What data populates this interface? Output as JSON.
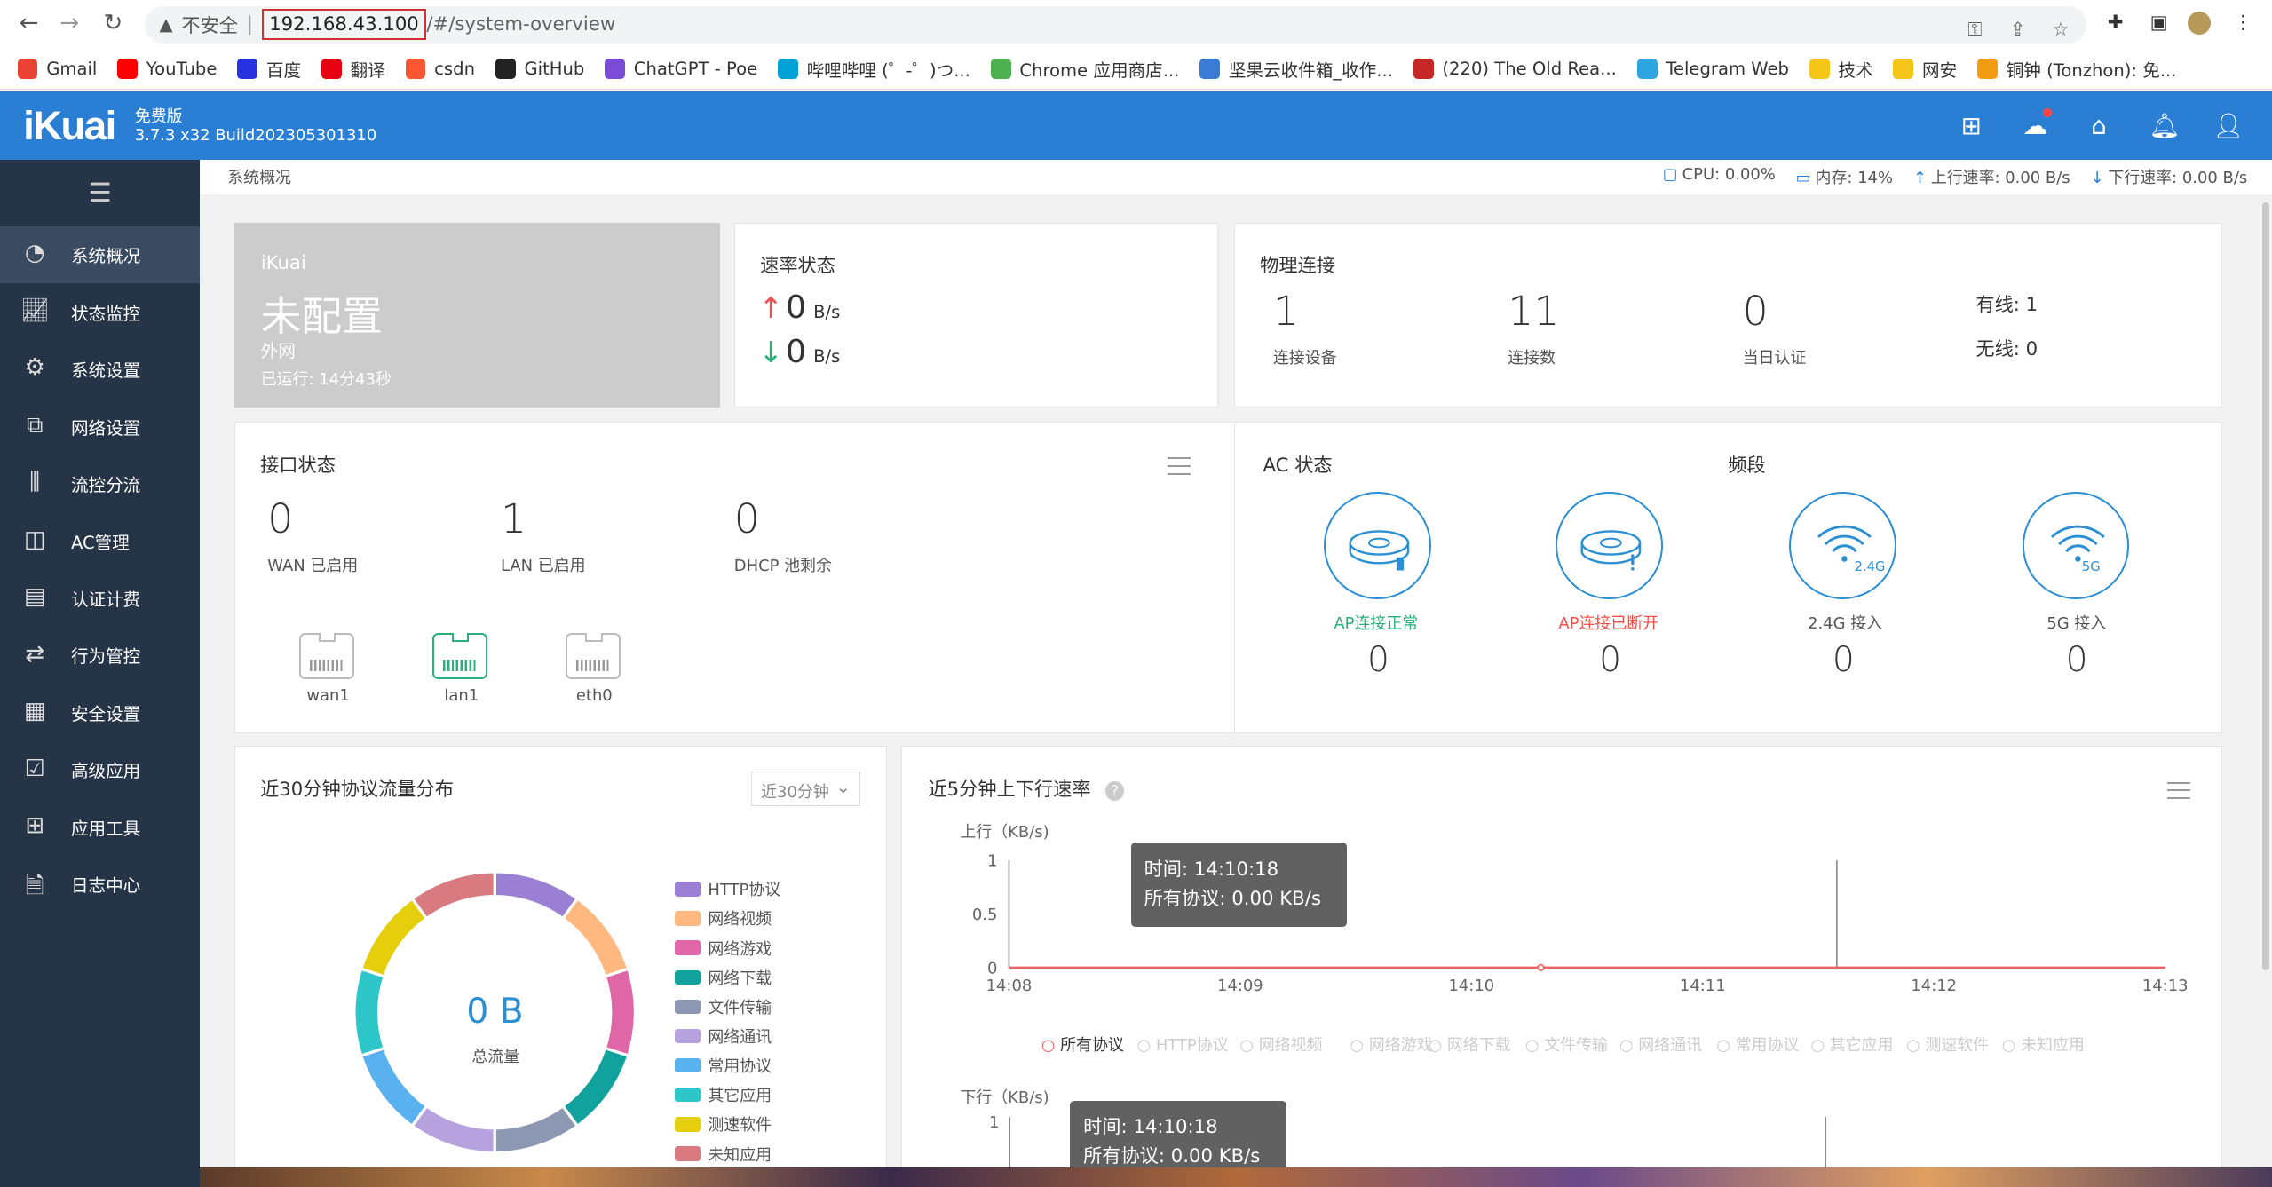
{
  "browser": {
    "insecure_label": "不安全",
    "url_host": "192.168.43.100",
    "url_path": "/#/system-overview",
    "bookmarks": [
      {
        "label": "Gmail",
        "color": "#ea4335"
      },
      {
        "label": "YouTube",
        "color": "#ff0000"
      },
      {
        "label": "百度",
        "color": "#2932e1"
      },
      {
        "label": "翻译",
        "color": "#e60012"
      },
      {
        "label": "csdn",
        "color": "#fc5531"
      },
      {
        "label": "GitHub",
        "color": "#222222"
      },
      {
        "label": "ChatGPT - Poe",
        "color": "#7b4bd6"
      },
      {
        "label": "哔哩哔哩 (゜-゜)つ...",
        "color": "#00a1d6"
      },
      {
        "label": "Chrome 应用商店...",
        "color": "#4caf50"
      },
      {
        "label": "坚果云收件箱_收作...",
        "color": "#3a7bd5"
      },
      {
        "label": "(220) The Old Rea...",
        "color": "#c62828"
      },
      {
        "label": "Telegram Web",
        "color": "#2ca5e0"
      },
      {
        "label": "技术",
        "color": "#f5c518"
      },
      {
        "label": "网安",
        "color": "#f5c518"
      },
      {
        "label": "铜钟 (Tonzhon): 免...",
        "color": "#f39c12"
      }
    ]
  },
  "header": {
    "logo": "iKuai",
    "edition": "免费版",
    "version": "3.7.3 x32 Build202305301310"
  },
  "sidebar": {
    "items": [
      {
        "label": "系统概况",
        "icon": "dashboard-icon"
      },
      {
        "label": "状态监控",
        "icon": "monitor-icon"
      },
      {
        "label": "系统设置",
        "icon": "gear-icon"
      },
      {
        "label": "网络设置",
        "icon": "network-icon"
      },
      {
        "label": "流控分流",
        "icon": "sliders-icon"
      },
      {
        "label": "AC管理",
        "icon": "ac-icon"
      },
      {
        "label": "认证计费",
        "icon": "auth-icon"
      },
      {
        "label": "行为管控",
        "icon": "arrows-icon"
      },
      {
        "label": "安全设置",
        "icon": "firewall-icon"
      },
      {
        "label": "高级应用",
        "icon": "advanced-icon"
      },
      {
        "label": "应用工具",
        "icon": "tools-icon"
      },
      {
        "label": "日志中心",
        "icon": "log-icon"
      }
    ]
  },
  "breadcrumb": "系统概况",
  "stats": {
    "cpu": "CPU: 0.00%",
    "mem": "内存: 14%",
    "up": "上行速率: 0.00 B/s",
    "down": "下行速率: 0.00 B/s"
  },
  "wan_card": {
    "name": "iKuai",
    "status": "未配置",
    "type": "外网",
    "uptime": "已运行: 14分43秒"
  },
  "speed_card": {
    "title": "速率状态",
    "up_value": "0",
    "up_unit": "B/s",
    "down_value": "0",
    "down_unit": "B/s"
  },
  "phys_card": {
    "title": "物理连接",
    "devices_value": "1",
    "devices_label": "连接设备",
    "conns_value": "11",
    "conns_label": "连接数",
    "auth_value": "0",
    "auth_label": "当日认证",
    "wired": "有线: 1",
    "wireless": "无线: 0"
  },
  "iface_card": {
    "title": "接口状态",
    "wan_value": "0",
    "wan_label": "WAN 已启用",
    "lan_value": "1",
    "lan_label": "LAN 已启用",
    "dhcp_value": "0",
    "dhcp_label": "DHCP 池剩余",
    "ports": [
      "wan1",
      "lan1",
      "eth0"
    ]
  },
  "ac_card": {
    "title": "AC 状态",
    "band_title": "频段",
    "ap_ok_label": "AP连接正常",
    "ap_ok_value": "0",
    "ap_down_label": "AP连接已断开",
    "ap_down_value": "0",
    "g24_label": "2.4G 接入",
    "g24_badge": "2.4G",
    "g24_value": "0",
    "g5_label": "5G 接入",
    "g5_badge": "5G",
    "g5_value": "0",
    "ok_color": "#2cb07b",
    "down_color": "#f0504a"
  },
  "proto_card": {
    "title": "近30分钟协议流量分布",
    "select": "近30分钟",
    "total_value": "0 B",
    "total_label": "总流量",
    "legend": [
      {
        "label": "HTTP协议",
        "color": "#9b7fd4"
      },
      {
        "label": "网络视频",
        "color": "#ffb980"
      },
      {
        "label": "网络游戏",
        "color": "#e066a8"
      },
      {
        "label": "网络下载",
        "color": "#12a29e"
      },
      {
        "label": "文件传输",
        "color": "#8d98b3"
      },
      {
        "label": "网络通讯",
        "color": "#b6a2de"
      },
      {
        "label": "常用协议",
        "color": "#5ab1ef"
      },
      {
        "label": "其它应用",
        "color": "#2ec7c9"
      },
      {
        "label": "测速软件",
        "color": "#e5cf0d"
      },
      {
        "label": "未知应用",
        "color": "#d87a80"
      }
    ]
  },
  "rate_card": {
    "title": "近5分钟上下行速率",
    "up_axis_label": "上行（KB/s)",
    "down_axis_label": "下行（KB/s)",
    "tooltip_time": "时间:  14:10:18",
    "tooltip_value": "所有协议:  0.00 KB/s",
    "filters": [
      "所有协议",
      "HTTP协议",
      "网络视频",
      "网络游戏",
      "网络下载",
      "文件传输",
      "网络通讯",
      "常用协议",
      "其它应用",
      "测速软件",
      "未知应用"
    ]
  },
  "chart_data": [
    {
      "type": "pie",
      "title": "近30分钟协议流量分布",
      "categories": [
        "HTTP协议",
        "网络视频",
        "网络游戏",
        "网络下载",
        "文件传输",
        "网络通讯",
        "常用协议",
        "其它应用",
        "测速软件",
        "未知应用"
      ],
      "values": [
        1,
        1,
        1,
        1,
        1,
        1,
        1,
        1,
        1,
        1
      ],
      "colors": [
        "#9b7fd4",
        "#ffb980",
        "#e066a8",
        "#12a29e",
        "#8d98b3",
        "#b6a2de",
        "#5ab1ef",
        "#2ec7c9",
        "#e5cf0d",
        "#d87a80"
      ]
    },
    {
      "type": "line",
      "title": "近5分钟上下行速率",
      "ylabel": "上行（KB/s)",
      "x": [
        "14:08",
        "14:09",
        "14:10",
        "14:11",
        "14:12",
        "14:13"
      ],
      "ylim": [
        0,
        1
      ],
      "yticks": [
        "0",
        "0.5",
        "1"
      ],
      "series": [
        {
          "name": "所有协议",
          "values": [
            0,
            0,
            0,
            0,
            0,
            0
          ],
          "color": "#f06060"
        }
      ]
    }
  ]
}
